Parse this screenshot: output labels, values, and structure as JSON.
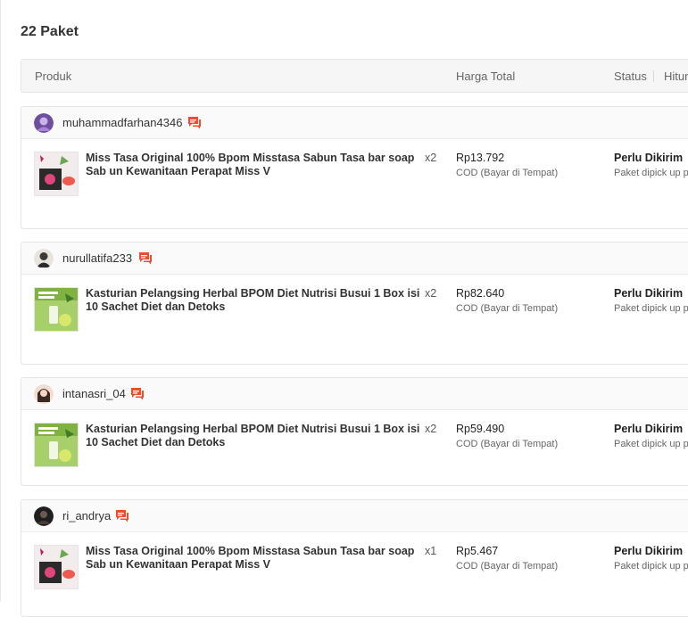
{
  "page": {
    "title": "22 Paket"
  },
  "table_header": {
    "product": "Produk",
    "total_price": "Harga Total",
    "status": "Status",
    "countdown": "Hitun"
  },
  "colors": {
    "accent": "#ee4d2d"
  },
  "orders": [
    {
      "username": "muhammadfarhan4346",
      "product_name": "Miss Tasa Original 100% Bpom Misstasa Sabun Tasa bar soap Sab un Kewanitaan Perapat Miss V",
      "quantity": "x2",
      "price": "Rp13.792",
      "payment": "COD (Bayar di Tempat)",
      "status": "Perlu Dikirim",
      "status_detail": "Paket dipick up pa"
    },
    {
      "username": "nurullatifa233",
      "product_name": "Kasturian Pelangsing Herbal BPOM Diet Nutrisi Busui 1 Box isi 10 Sachet Diet dan Detoks",
      "quantity": "x2",
      "price": "Rp82.640",
      "payment": "COD (Bayar di Tempat)",
      "status": "Perlu Dikirim",
      "status_detail": "Paket dipick up pa"
    },
    {
      "username": "intanasri_04",
      "product_name": "Kasturian Pelangsing Herbal BPOM Diet Nutrisi Busui 1 Box isi 10 Sachet Diet dan Detoks",
      "quantity": "x2",
      "price": "Rp59.490",
      "payment": "COD (Bayar di Tempat)",
      "status": "Perlu Dikirim",
      "status_detail": "Paket dipick up pa"
    },
    {
      "username": "ri_andrya",
      "product_name": "Miss Tasa Original 100% Bpom Misstasa Sabun Tasa bar soap Sab un Kewanitaan Perapat Miss V",
      "quantity": "x1",
      "price": "Rp5.467",
      "payment": "COD (Bayar di Tempat)",
      "status": "Perlu Dikirim",
      "status_detail": "Paket dipick up pa"
    }
  ]
}
